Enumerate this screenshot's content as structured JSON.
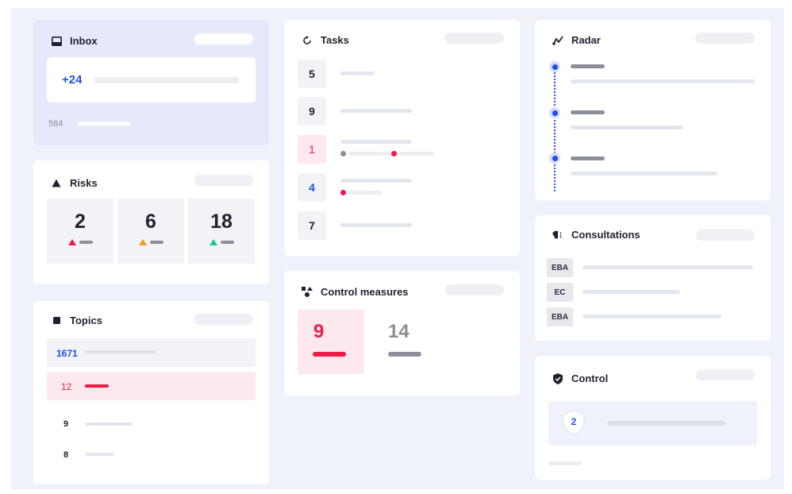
{
  "colors": {
    "accent_blue": "#1e4fe6",
    "accent_red": "#ee1b47",
    "orange": "#f39a1e",
    "green": "#23c98a"
  },
  "inbox": {
    "title": "Inbox",
    "icon": "inbox-icon",
    "new_count": "+24",
    "total": "584"
  },
  "risks": {
    "title": "Risks",
    "icon": "triangle-icon",
    "items": [
      {
        "value": "2",
        "color": "#ee1b47"
      },
      {
        "value": "6",
        "color": "#f39a1e"
      },
      {
        "value": "18",
        "color": "#23c98a"
      }
    ]
  },
  "topics": {
    "title": "Topics",
    "icon": "square-icon",
    "rows": [
      {
        "value": "1671"
      },
      {
        "value": "12"
      },
      {
        "value": "9"
      },
      {
        "value": "8"
      }
    ]
  },
  "tasks": {
    "title": "Tasks",
    "icon": "refresh-icon",
    "items": [
      {
        "value": "5"
      },
      {
        "value": "9"
      },
      {
        "value": "1"
      },
      {
        "value": "4"
      },
      {
        "value": "7"
      }
    ]
  },
  "control_measures": {
    "title": "Control measures",
    "icon": "shapes-icon",
    "primary": "9",
    "secondary": "14"
  },
  "radar": {
    "title": "Radar",
    "icon": "radar-icon"
  },
  "consultations": {
    "title": "Consultations",
    "icon": "speaker-icon",
    "tags": [
      "EBA",
      "EC",
      "EBA"
    ]
  },
  "control": {
    "title": "Control",
    "icon": "shield-check-icon",
    "value": "2"
  }
}
